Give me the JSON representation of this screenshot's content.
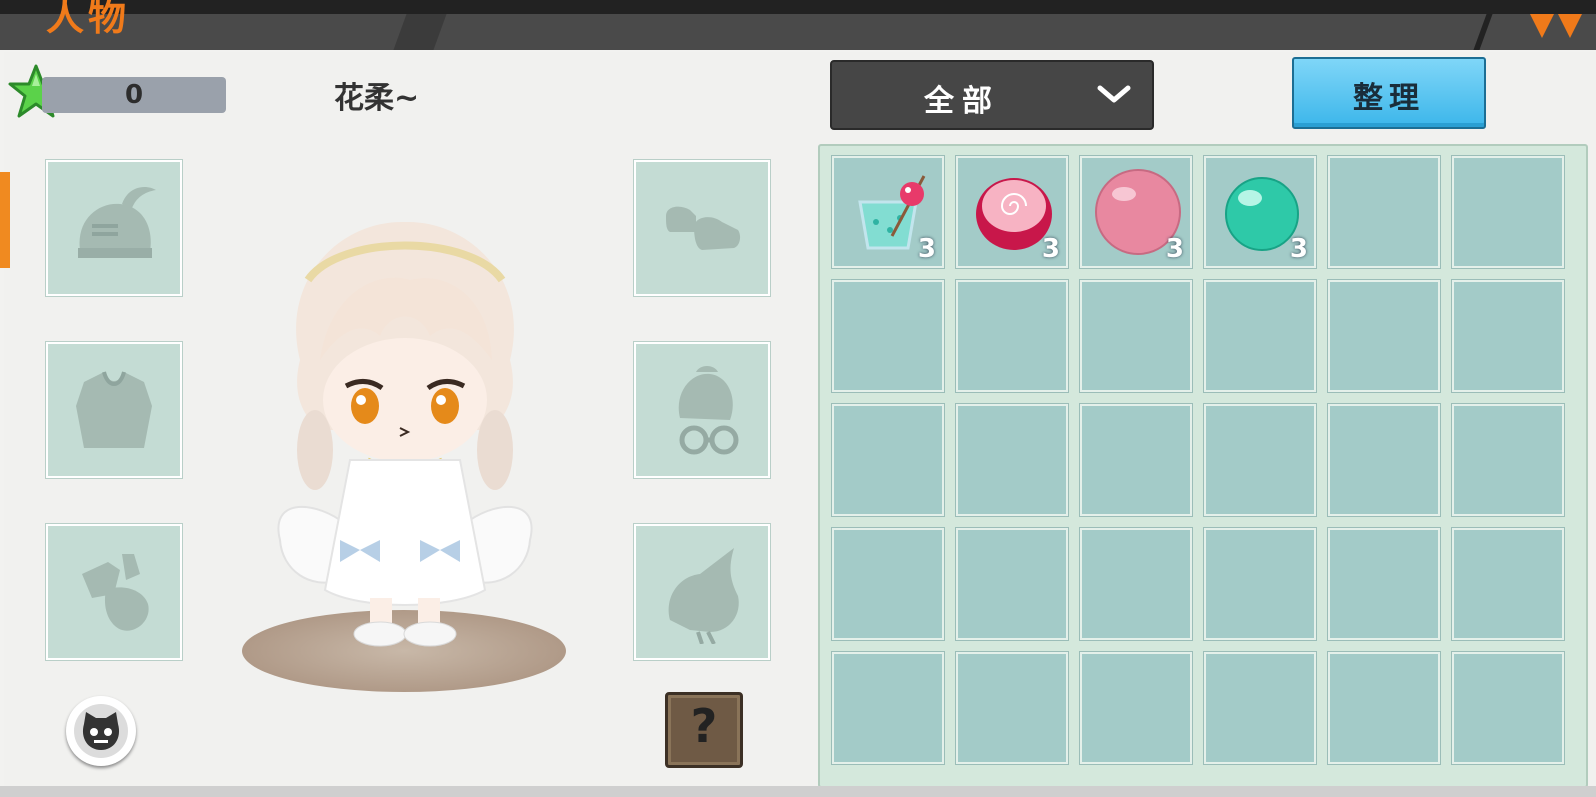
{
  "header": {
    "title": "人物"
  },
  "currency": {
    "icon": "green-star-icon",
    "value": "0"
  },
  "character": {
    "name": "花柔~"
  },
  "equipment_slots": {
    "left": [
      "helmet-slot-icon",
      "chest-armor-slot-icon",
      "gloves-slot-icon"
    ],
    "right": [
      "shoes-slot-icon",
      "accessory-slot-icon",
      "wings-slot-icon"
    ]
  },
  "filter": {
    "selected": "全部"
  },
  "actions": {
    "sort_label": "整理"
  },
  "inventory": {
    "items": [
      {
        "icon": "drink-cup-icon",
        "count": "3"
      },
      {
        "icon": "swirl-candy-icon",
        "count": "3"
      },
      {
        "icon": "pink-ball-icon",
        "count": "3"
      },
      {
        "icon": "teal-ball-icon",
        "count": "3"
      }
    ],
    "total_slots": 30
  },
  "colors": {
    "accent": "#f07a1a",
    "slot_bg": "#c4dcd4",
    "cell_bg": "#a3cbc8",
    "sort_button": "#3cb6ea"
  }
}
